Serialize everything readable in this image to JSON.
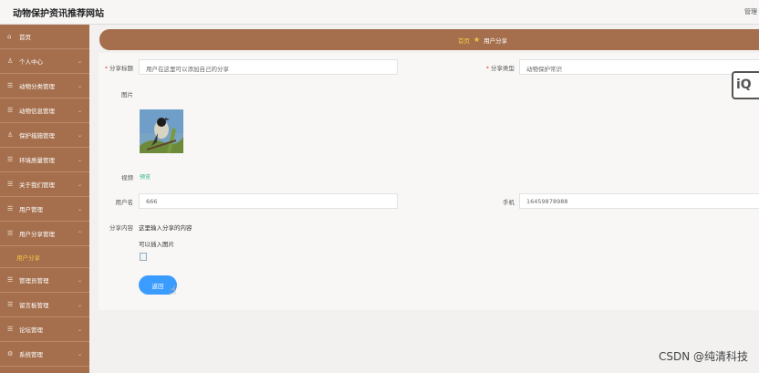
{
  "app": {
    "title": "动物保护资讯推荐网站",
    "user_menu": "管理"
  },
  "sidebar": {
    "items": [
      {
        "label": "首页",
        "icon": "home-icon"
      },
      {
        "label": "个人中心",
        "icon": "user-icon"
      },
      {
        "label": "动物分类管理",
        "icon": "menu-icon"
      },
      {
        "label": "动物信息管理",
        "icon": "menu-icon"
      },
      {
        "label": "保护措施管理",
        "icon": "user-icon"
      },
      {
        "label": "环境质量管理",
        "icon": "menu-icon"
      },
      {
        "label": "关于我们管理",
        "icon": "menu-icon"
      },
      {
        "label": "用户管理",
        "icon": "menu-icon"
      },
      {
        "label": "用户分享管理",
        "icon": "menu-icon"
      }
    ],
    "sub_active": "用户分享",
    "items_after": [
      {
        "label": "管理员管理",
        "icon": "menu-icon"
      },
      {
        "label": "留言板管理",
        "icon": "menu-icon"
      },
      {
        "label": "论坛管理",
        "icon": "menu-icon"
      },
      {
        "label": "系统管理",
        "icon": "menu-icon"
      }
    ]
  },
  "breadcrumb": {
    "home": "首页",
    "current": "用户分享"
  },
  "form": {
    "share_title_label": "分享标题",
    "share_title_value": "用户在这里可以添加自己的分享",
    "share_type_label": "分享类型",
    "share_type_value": "动物保护常识",
    "image_label": "图片",
    "video_label": "视频",
    "video_link": "预览",
    "username_label": "用户名",
    "username_value": "666",
    "phone_label": "手机",
    "phone_value": "16459878988",
    "content_label": "分享内容",
    "content_line1": "这里输入分享的内容",
    "content_line2": "可以插入图片",
    "back_button": "返回"
  },
  "overlay": {
    "logo_text": "iQ",
    "watermark": "CSDN @纯清科技"
  },
  "colors": {
    "sidebar": "#a56f4d",
    "accent_yellow": "#f6c544",
    "button_blue": "#3a9cff"
  }
}
